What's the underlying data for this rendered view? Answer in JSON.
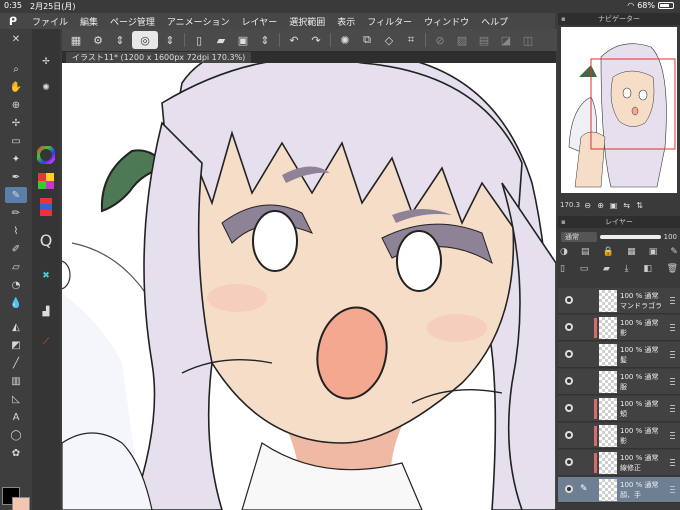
{
  "status": {
    "time": "0:35",
    "date": "2月25日(月)",
    "battery": "68%"
  },
  "menu": [
    "ファイル",
    "編集",
    "ページ管理",
    "アニメーション",
    "レイヤー",
    "選択範囲",
    "表示",
    "フィルター",
    "ウィンドウ",
    "ヘルプ"
  ],
  "canvas_tab": "イラスト11* (1200 x 1600px 72dpi 170.3%)",
  "navigator": {
    "title": "ナビゲーター",
    "zoom": "170.3",
    "rotation": "0.0"
  },
  "layers_panel": {
    "title": "レイヤー",
    "blend_mode": "通常",
    "opacity": "100",
    "items": [
      {
        "opacity": "100 %",
        "mode": "通常",
        "name": "マンドラゴラ",
        "has_mark": false,
        "selected": false
      },
      {
        "opacity": "100 %",
        "mode": "通常",
        "name": "影",
        "has_mark": true,
        "selected": false
      },
      {
        "opacity": "100 %",
        "mode": "通常",
        "name": "髪",
        "has_mark": false,
        "selected": false
      },
      {
        "opacity": "100 %",
        "mode": "通常",
        "name": "服",
        "has_mark": false,
        "selected": false
      },
      {
        "opacity": "100 %",
        "mode": "通常",
        "name": "頬",
        "has_mark": true,
        "selected": false
      },
      {
        "opacity": "100 %",
        "mode": "通常",
        "name": "影",
        "has_mark": true,
        "selected": false
      },
      {
        "opacity": "100 %",
        "mode": "通常",
        "name": "線修正",
        "has_mark": true,
        "selected": false
      },
      {
        "opacity": "100 %",
        "mode": "通常",
        "name": "顔、手",
        "has_mark": false,
        "selected": true
      }
    ]
  },
  "colors": {
    "main": "#000000",
    "sub": "#f4c6b0",
    "accent": "#5a7fa8"
  }
}
